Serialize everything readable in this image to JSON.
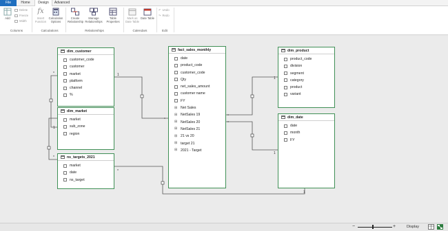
{
  "ribbon": {
    "tabs": {
      "file": "File",
      "home": "Home",
      "design": "Design",
      "advanced": "Advanced"
    },
    "buttons": {
      "add": "Add",
      "delete": "Delete",
      "freeze": "Freeze",
      "width": "Width",
      "insert_function": "Insert Function",
      "calculation_options": "Calculation Options",
      "create_relationship": "Create Relationship",
      "manage_relationships": "Manage Relationships",
      "table_properties": "Table Properties",
      "mark_as_date_table": "Mark as Date Table",
      "date_table": "Date Table",
      "undo": "Undo",
      "redo": "Redo"
    },
    "groups": {
      "columns": "Columns",
      "calculations": "Calculations",
      "relationships": "Relationships",
      "calendars": "Calendars",
      "edit": "Edit"
    }
  },
  "tables": {
    "dim_customer": {
      "name": "dim_customer",
      "fields": [
        "customer_code",
        "customer",
        "market",
        "platform",
        "channel",
        "%"
      ]
    },
    "dim_market": {
      "name": "dim_market",
      "fields": [
        "market",
        "sub_zone",
        "region"
      ]
    },
    "ns_targets": {
      "name": "ns_targets_2021",
      "fields": [
        "market",
        "date",
        "ns_target"
      ]
    },
    "fact": {
      "name": "fact_sales_monthly",
      "fields": [
        "date",
        "product_code",
        "customer_code",
        "Qty",
        "net_sales_amount",
        "customer name",
        "FY",
        "Net Sales",
        "NetSales 19",
        "NetSales 20",
        "NetSales 21",
        "21 vs 20",
        "target 21",
        "2021 - Target"
      ]
    },
    "dim_product": {
      "name": "dim_product",
      "fields": [
        "product_code",
        "division",
        "segment",
        "category",
        "product",
        "variant"
      ]
    },
    "dim_date": {
      "name": "dim_date",
      "fields": [
        "date",
        "month",
        "FY"
      ]
    }
  },
  "relationships": {
    "one": "1",
    "many": "*"
  },
  "statusbar": {
    "display": "Display",
    "zoom_in": "+",
    "zoom_out": "−"
  },
  "colors": {
    "table_border": "#3f8f55",
    "file_tab": "#1f6fbf",
    "canvas": "#ebebeb"
  }
}
